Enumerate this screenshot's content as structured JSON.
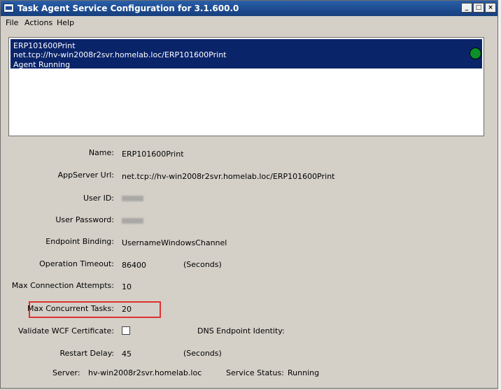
{
  "window": {
    "title": "Task Agent Service Configuration for 3.1.600.0"
  },
  "menu": [
    "File",
    "Actions",
    "Help"
  ],
  "agent_list": [
    {
      "name": "ERP101600Print",
      "url": "net.tcp://hv-win2008r2svr.homelab.loc/ERP101600Print",
      "status": "Agent Running",
      "status_color": "#0a8f2a"
    }
  ],
  "form": {
    "name_label": "Name:",
    "name_value": "ERP101600Print",
    "appserver_label": "AppServer Url:",
    "appserver_value": "net.tcp://hv-win2008r2svr.homelab.loc/ERP101600Print",
    "userid_label": "User ID:",
    "password_label": "User Password:",
    "binding_label": "Endpoint Binding:",
    "binding_value": "UsernameWindowsChannel",
    "timeout_label": "Operation Timeout:",
    "timeout_value": "86400",
    "timeout_unit": "(Seconds)",
    "max_conn_label": "Max Connection Attempts:",
    "max_conn_value": "10",
    "max_tasks_label": "Max Concurrent Tasks:",
    "max_tasks_value": "20",
    "validate_label": "Validate WCF Certificate:",
    "validate_checked": false,
    "dns_label": "DNS Endpoint Identity:",
    "restart_label": "Restart Delay:",
    "restart_value": "45",
    "restart_unit": "(Seconds)",
    "server_label": "Server:",
    "server_value": "hv-win2008r2svr.homelab.loc",
    "service_status_label": "Service Status:",
    "service_status_value": "Running"
  },
  "colors": {
    "selection": "#0a246a",
    "highlight_box": "#e03030"
  }
}
